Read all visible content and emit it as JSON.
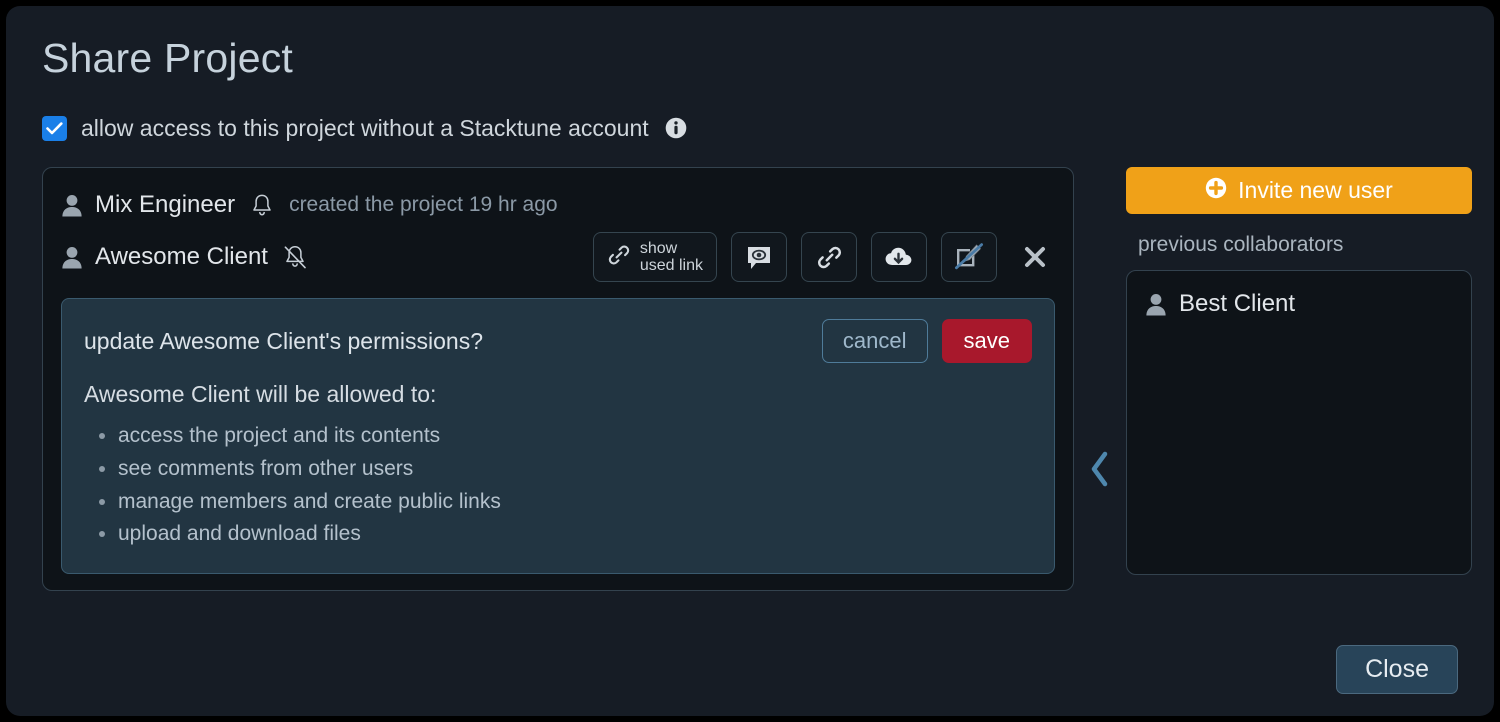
{
  "dialog": {
    "title": "Share Project",
    "close_label": "Close"
  },
  "allow_access": {
    "label": "allow access to this project without a Stacktune account",
    "checked": true,
    "checkbox_icon": "checkmark-icon",
    "info_icon": "info-icon"
  },
  "members": [
    {
      "name": "Mix Engineer",
      "person_icon": "person-icon",
      "bell_icon": "bell-icon",
      "bell_state": "on",
      "meta": "created the project 19 hr ago"
    },
    {
      "name": "Awesome Client",
      "person_icon": "person-icon",
      "bell_icon": "bell-slash-icon",
      "bell_state": "muted",
      "meta": "",
      "actions": {
        "show_used_link": {
          "icon": "link-icon",
          "line1": "show",
          "line2": "used link"
        },
        "buttons": [
          {
            "icon": "comment-eye-icon",
            "name": "view-comments-button"
          },
          {
            "icon": "link-icon",
            "name": "public-link-button"
          },
          {
            "icon": "cloud-download-icon",
            "name": "download-button"
          },
          {
            "icon": "edit-disabled-icon",
            "name": "edit-permission-button"
          }
        ],
        "remove": {
          "icon": "close-x-icon"
        }
      }
    }
  ],
  "permissions": {
    "question": "update Awesome Client's permissions?",
    "cancel_label": "cancel",
    "save_label": "save",
    "subtitle": "Awesome Client will be allowed to:",
    "items": [
      "access the project and its contents",
      "see comments from other users",
      "manage members and create public links",
      "upload and download files"
    ]
  },
  "divider": {
    "icon": "chevron-left-icon"
  },
  "sidebar": {
    "invite_label": "Invite new user",
    "invite_icon": "plus-circle-icon",
    "section_label": "previous collaborators",
    "collaborators": [
      {
        "name": "Best Client",
        "person_icon": "person-icon"
      }
    ]
  },
  "colors": {
    "accent_orange": "#f0a118",
    "accent_blue": "#1a7fe8",
    "danger_red": "#a8182c",
    "panel_bg": "#0e1318",
    "dialog_bg": "#161c25",
    "perm_bg": "#223542",
    "chevron_blue": "#4e87ad"
  }
}
